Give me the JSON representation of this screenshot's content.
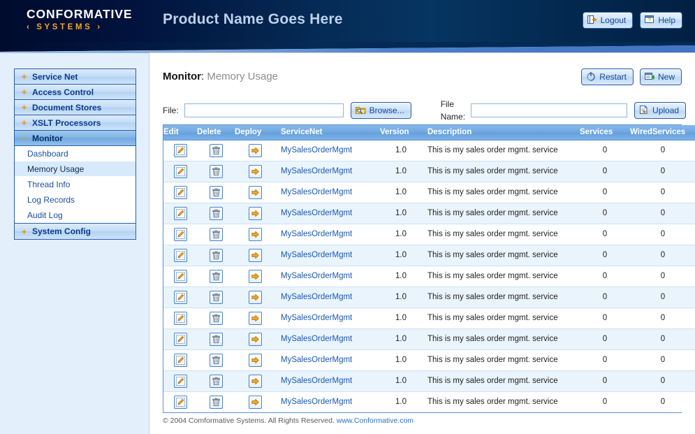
{
  "header": {
    "logo_main": "CONFORMATIVE",
    "logo_sub": "SYSTEMS",
    "logo_bracket_left": "‹",
    "logo_bracket_right": "›",
    "product_title": "Product Name Goes Here",
    "logout_label": "Logout",
    "help_label": "Help"
  },
  "sidebar": {
    "items": [
      {
        "label": "Service Net",
        "marker": "+",
        "expanded": false,
        "selected": false
      },
      {
        "label": "Access Control",
        "marker": "+",
        "expanded": false,
        "selected": false
      },
      {
        "label": "Document Stores",
        "marker": "+",
        "expanded": false,
        "selected": false
      },
      {
        "label": "XSLT Processors",
        "marker": "+",
        "expanded": false,
        "selected": false
      },
      {
        "label": "Monitor",
        "marker": "−",
        "expanded": true,
        "selected": true
      },
      {
        "label": "System Config",
        "marker": "+",
        "expanded": false,
        "selected": false
      }
    ],
    "monitor_children": [
      {
        "label": "Dashboard",
        "selected": false
      },
      {
        "label": "Memory Usage",
        "selected": true
      },
      {
        "label": "Thread Info",
        "selected": false
      },
      {
        "label": "Log Records",
        "selected": false
      },
      {
        "label": "Audit Log",
        "selected": false
      }
    ]
  },
  "page": {
    "section": "Monitor",
    "separator": ":",
    "subsection": "Memory Usage",
    "restart_label": "Restart",
    "new_label": "New"
  },
  "filebar": {
    "file_label": "File:",
    "file_value": "",
    "file_placeholder": "",
    "browse_label": "Browse...",
    "filename_label": "File Name:",
    "filename_value": "",
    "filename_placeholder": "",
    "upload_label": "Upload"
  },
  "table": {
    "columns": [
      "Edit",
      "Delete",
      "Deploy",
      "ServiceNet",
      "Version",
      "Description",
      "Services",
      "WiredServices"
    ],
    "rows": [
      {
        "servicenet": "MySalesOrderMgmt",
        "version": "1.0",
        "description": "This is my sales order mgmt. service",
        "services": "0",
        "wired_services": "0"
      },
      {
        "servicenet": "MySalesOrderMgmt",
        "version": "1.0",
        "description": "This is my sales order mgmt. service",
        "services": "0",
        "wired_services": "0"
      },
      {
        "servicenet": "MySalesOrderMgmt",
        "version": "1.0",
        "description": "This is my sales order mgmt. service",
        "services": "0",
        "wired_services": "0"
      },
      {
        "servicenet": "MySalesOrderMgmt",
        "version": "1.0",
        "description": "This is my sales order mgmt. service",
        "services": "0",
        "wired_services": "0"
      },
      {
        "servicenet": "MySalesOrderMgmt",
        "version": "1.0",
        "description": "This is my sales order mgmt. service",
        "services": "0",
        "wired_services": "0"
      },
      {
        "servicenet": "MySalesOrderMgmt",
        "version": "1.0",
        "description": "This is my sales order mgmt. service",
        "services": "0",
        "wired_services": "0"
      },
      {
        "servicenet": "MySalesOrderMgmt",
        "version": "1.0",
        "description": "This is my sales order mgmt. service",
        "services": "0",
        "wired_services": "0"
      },
      {
        "servicenet": "MySalesOrderMgmt",
        "version": "1.0",
        "description": "This is my sales order mgmt. service",
        "services": "0",
        "wired_services": "0"
      },
      {
        "servicenet": "MySalesOrderMgmt",
        "version": "1.0",
        "description": "This is my sales order mgmt. service",
        "services": "0",
        "wired_services": "0"
      },
      {
        "servicenet": "MySalesOrderMgmt",
        "version": "1.0",
        "description": "This is my sales order mgmt. service",
        "services": "0",
        "wired_services": "0"
      },
      {
        "servicenet": "MySalesOrderMgmt",
        "version": "1.0",
        "description": "This is my sales order mgmt. service",
        "services": "0",
        "wired_services": "0"
      },
      {
        "servicenet": "MySalesOrderMgmt",
        "version": "1.0",
        "description": "This is my sales order mgmt. service",
        "services": "0",
        "wired_services": "0"
      },
      {
        "servicenet": "MySalesOrderMgmt",
        "version": "1.0",
        "description": "This is my sales order mgmt. service",
        "services": "0",
        "wired_services": "0"
      }
    ]
  },
  "footer": {
    "copyright": "© 2004 Comformative Systems. All Rights Reserved.",
    "link": "www.Conformative.com"
  },
  "colors": {
    "header_navy": "#052a55",
    "accent_orange": "#f5a623",
    "link_blue": "#1b59b0",
    "table_header_blue": "#6ea7e2",
    "row_alt_blue": "#e9f4fd",
    "sidebar_bg": "#e3f0fc"
  }
}
